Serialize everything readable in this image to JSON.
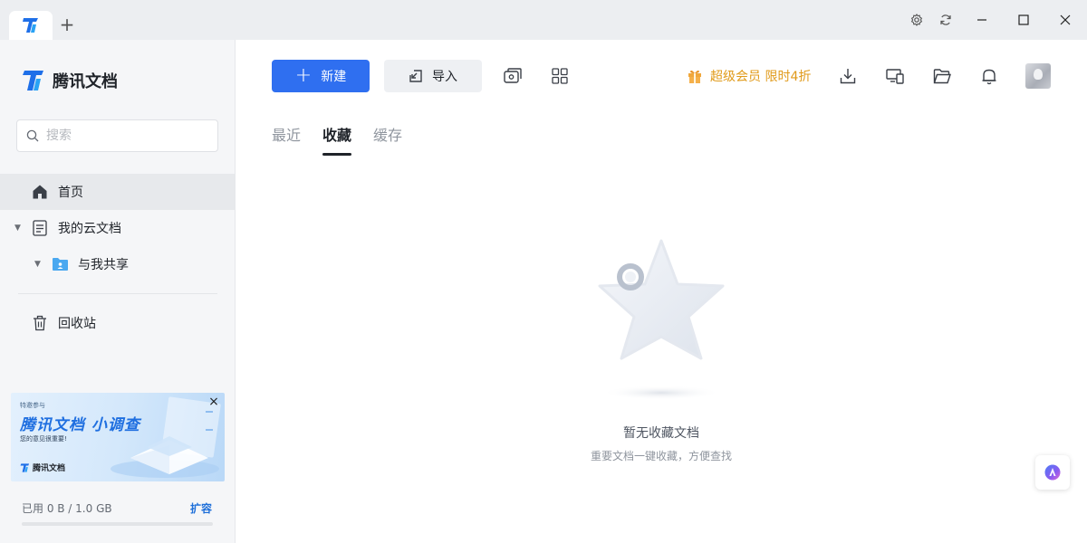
{
  "titlebar": {
    "new_tab_label": "+",
    "icons": [
      "tencent-docs-logo-icon",
      "settings-icon",
      "sync-icon",
      "minimize-icon",
      "maximize-icon",
      "close-icon"
    ]
  },
  "sidebar": {
    "app_name": "腾讯文档",
    "search_placeholder": "搜索",
    "items": [
      {
        "label": "首页",
        "icon": "home-icon",
        "active": true
      },
      {
        "label": "我的云文档",
        "icon": "document-icon",
        "expandable": true
      },
      {
        "label": "与我共享",
        "icon": "shared-folder-icon",
        "expandable": true
      },
      {
        "label": "回收站",
        "icon": "trash-icon"
      }
    ],
    "banner": {
      "kicker": "特邀参与",
      "title": "腾讯文档 小调查",
      "subtitle": "您的意见很重要!",
      "brand": "腾讯文档",
      "close": "×"
    },
    "storage": {
      "text": "已用 0 B / 1.0 GB",
      "used_fraction": 0,
      "expand_label": "扩容"
    }
  },
  "toolbar": {
    "new_label": "新建",
    "import_label": "导入",
    "vip_label": "超级会员 限时4折",
    "colors": {
      "primary": "#2f6ff0",
      "vip": "#e09a1a"
    }
  },
  "tabs": [
    {
      "label": "最近",
      "active": false
    },
    {
      "label": "收藏",
      "active": true
    },
    {
      "label": "缓存",
      "active": false
    }
  ],
  "empty_state": {
    "title": "暂无收藏文档",
    "subtitle": "重要文档一键收藏，方便查找"
  }
}
